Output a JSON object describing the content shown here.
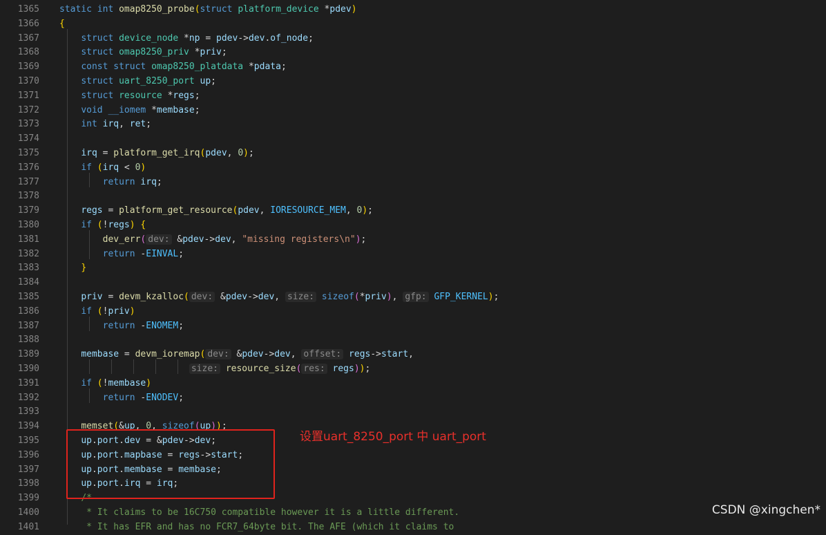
{
  "lines": [
    {
      "n": "1365",
      "t": [
        [
          "kw",
          "static "
        ],
        [
          "kw",
          "int "
        ],
        [
          "fn",
          "omap8250_probe"
        ],
        [
          "br1",
          "("
        ],
        [
          "kw",
          "struct "
        ],
        [
          "ty",
          "platform_device "
        ],
        [
          "op",
          "*"
        ],
        [
          "id",
          "pdev"
        ],
        [
          "br1",
          ")"
        ]
      ]
    },
    {
      "n": "1366",
      "t": [
        [
          "br1",
          "{"
        ]
      ]
    },
    {
      "n": "1367",
      "t": [
        [
          "op",
          "    "
        ],
        [
          "kw",
          "struct "
        ],
        [
          "ty",
          "device_node "
        ],
        [
          "op",
          "*"
        ],
        [
          "id",
          "np"
        ],
        [
          "op",
          " = "
        ],
        [
          "id",
          "pdev"
        ],
        [
          "op",
          "->"
        ],
        [
          "id",
          "dev"
        ],
        [
          "op",
          "."
        ],
        [
          "id",
          "of_node"
        ],
        [
          "op",
          ";"
        ]
      ]
    },
    {
      "n": "1368",
      "t": [
        [
          "op",
          "    "
        ],
        [
          "kw",
          "struct "
        ],
        [
          "ty",
          "omap8250_priv "
        ],
        [
          "op",
          "*"
        ],
        [
          "id",
          "priv"
        ],
        [
          "op",
          ";"
        ]
      ]
    },
    {
      "n": "1369",
      "t": [
        [
          "op",
          "    "
        ],
        [
          "kw",
          "const "
        ],
        [
          "kw",
          "struct "
        ],
        [
          "ty",
          "omap8250_platdata "
        ],
        [
          "op",
          "*"
        ],
        [
          "id",
          "pdata"
        ],
        [
          "op",
          ";"
        ]
      ]
    },
    {
      "n": "1370",
      "t": [
        [
          "op",
          "    "
        ],
        [
          "kw",
          "struct "
        ],
        [
          "ty",
          "uart_8250_port "
        ],
        [
          "id",
          "up"
        ],
        [
          "op",
          ";"
        ]
      ]
    },
    {
      "n": "1371",
      "t": [
        [
          "op",
          "    "
        ],
        [
          "kw",
          "struct "
        ],
        [
          "ty",
          "resource "
        ],
        [
          "op",
          "*"
        ],
        [
          "id",
          "regs"
        ],
        [
          "op",
          ";"
        ]
      ]
    },
    {
      "n": "1372",
      "t": [
        [
          "op",
          "    "
        ],
        [
          "kw",
          "void "
        ],
        [
          "kw",
          "__iomem "
        ],
        [
          "op",
          "*"
        ],
        [
          "id",
          "membase"
        ],
        [
          "op",
          ";"
        ]
      ]
    },
    {
      "n": "1373",
      "t": [
        [
          "op",
          "    "
        ],
        [
          "kw",
          "int "
        ],
        [
          "id",
          "irq"
        ],
        [
          "op",
          ", "
        ],
        [
          "id",
          "ret"
        ],
        [
          "op",
          ";"
        ]
      ]
    },
    {
      "n": "1374",
      "t": []
    },
    {
      "n": "1375",
      "t": [
        [
          "op",
          "    "
        ],
        [
          "id",
          "irq"
        ],
        [
          "op",
          " = "
        ],
        [
          "fn",
          "platform_get_irq"
        ],
        [
          "br1",
          "("
        ],
        [
          "id",
          "pdev"
        ],
        [
          "op",
          ", "
        ],
        [
          "num",
          "0"
        ],
        [
          "br1",
          ")"
        ],
        [
          "op",
          ";"
        ]
      ]
    },
    {
      "n": "1376",
      "t": [
        [
          "op",
          "    "
        ],
        [
          "kw",
          "if "
        ],
        [
          "br1",
          "("
        ],
        [
          "id",
          "irq"
        ],
        [
          "op",
          " < "
        ],
        [
          "num",
          "0"
        ],
        [
          "br1",
          ")"
        ]
      ]
    },
    {
      "n": "1377",
      "t": [
        [
          "op",
          "        "
        ],
        [
          "kw",
          "return "
        ],
        [
          "id",
          "irq"
        ],
        [
          "op",
          ";"
        ]
      ]
    },
    {
      "n": "1378",
      "t": []
    },
    {
      "n": "1379",
      "t": [
        [
          "op",
          "    "
        ],
        [
          "id",
          "regs"
        ],
        [
          "op",
          " = "
        ],
        [
          "fn",
          "platform_get_resource"
        ],
        [
          "br1",
          "("
        ],
        [
          "id",
          "pdev"
        ],
        [
          "op",
          ", "
        ],
        [
          "mac",
          "IORESOURCE_MEM"
        ],
        [
          "op",
          ", "
        ],
        [
          "num",
          "0"
        ],
        [
          "br1",
          ")"
        ],
        [
          "op",
          ";"
        ]
      ]
    },
    {
      "n": "1380",
      "t": [
        [
          "op",
          "    "
        ],
        [
          "kw",
          "if "
        ],
        [
          "br1",
          "("
        ],
        [
          "op",
          "!"
        ],
        [
          "id",
          "regs"
        ],
        [
          "br1",
          ")"
        ],
        [
          "op",
          " "
        ],
        [
          "br1",
          "{"
        ]
      ]
    },
    {
      "n": "1381",
      "t": [
        [
          "op",
          "        "
        ],
        [
          "fn",
          "dev_err"
        ],
        [
          "br2",
          "("
        ],
        [
          "hint",
          "dev:"
        ],
        [
          "op",
          " &"
        ],
        [
          "id",
          "pdev"
        ],
        [
          "op",
          "->"
        ],
        [
          "id",
          "dev"
        ],
        [
          "op",
          ", "
        ],
        [
          "str",
          "\"missing registers\\n\""
        ],
        [
          "br2",
          ")"
        ],
        [
          "op",
          ";"
        ]
      ]
    },
    {
      "n": "1382",
      "t": [
        [
          "op",
          "        "
        ],
        [
          "kw",
          "return "
        ],
        [
          "op",
          "-"
        ],
        [
          "mac",
          "EINVAL"
        ],
        [
          "op",
          ";"
        ]
      ]
    },
    {
      "n": "1383",
      "t": [
        [
          "op",
          "    "
        ],
        [
          "br1",
          "}"
        ]
      ]
    },
    {
      "n": "1384",
      "t": []
    },
    {
      "n": "1385",
      "t": [
        [
          "op",
          "    "
        ],
        [
          "id",
          "priv"
        ],
        [
          "op",
          " = "
        ],
        [
          "fn",
          "devm_kzalloc"
        ],
        [
          "br1",
          "("
        ],
        [
          "hint",
          "dev:"
        ],
        [
          "op",
          " &"
        ],
        [
          "id",
          "pdev"
        ],
        [
          "op",
          "->"
        ],
        [
          "id",
          "dev"
        ],
        [
          "op",
          ", "
        ],
        [
          "hint",
          "size:"
        ],
        [
          "op",
          " "
        ],
        [
          "kw",
          "sizeof"
        ],
        [
          "br2",
          "("
        ],
        [
          "op",
          "*"
        ],
        [
          "id",
          "priv"
        ],
        [
          "br2",
          ")"
        ],
        [
          "op",
          ", "
        ],
        [
          "hint",
          "gfp:"
        ],
        [
          "op",
          " "
        ],
        [
          "mac",
          "GFP_KERNEL"
        ],
        [
          "br1",
          ")"
        ],
        [
          "op",
          ";"
        ]
      ]
    },
    {
      "n": "1386",
      "t": [
        [
          "op",
          "    "
        ],
        [
          "kw",
          "if "
        ],
        [
          "br1",
          "("
        ],
        [
          "op",
          "!"
        ],
        [
          "id",
          "priv"
        ],
        [
          "br1",
          ")"
        ]
      ]
    },
    {
      "n": "1387",
      "t": [
        [
          "op",
          "        "
        ],
        [
          "kw",
          "return "
        ],
        [
          "op",
          "-"
        ],
        [
          "mac",
          "ENOMEM"
        ],
        [
          "op",
          ";"
        ]
      ]
    },
    {
      "n": "1388",
      "t": []
    },
    {
      "n": "1389",
      "t": [
        [
          "op",
          "    "
        ],
        [
          "id",
          "membase"
        ],
        [
          "op",
          " = "
        ],
        [
          "fn",
          "devm_ioremap"
        ],
        [
          "br1",
          "("
        ],
        [
          "hint",
          "dev:"
        ],
        [
          "op",
          " &"
        ],
        [
          "id",
          "pdev"
        ],
        [
          "op",
          "->"
        ],
        [
          "id",
          "dev"
        ],
        [
          "op",
          ", "
        ],
        [
          "hint",
          "offset:"
        ],
        [
          "op",
          " "
        ],
        [
          "id",
          "regs"
        ],
        [
          "op",
          "->"
        ],
        [
          "id",
          "start"
        ],
        [
          "op",
          ","
        ]
      ]
    },
    {
      "n": "1390",
      "t": [
        [
          "op",
          "                        "
        ],
        [
          "hint",
          "size:"
        ],
        [
          "op",
          " "
        ],
        [
          "fn",
          "resource_size"
        ],
        [
          "br2",
          "("
        ],
        [
          "hint",
          "res:"
        ],
        [
          "op",
          " "
        ],
        [
          "id",
          "regs"
        ],
        [
          "br2",
          ")"
        ],
        [
          "br1",
          ")"
        ],
        [
          "op",
          ";"
        ]
      ]
    },
    {
      "n": "1391",
      "t": [
        [
          "op",
          "    "
        ],
        [
          "kw",
          "if "
        ],
        [
          "br1",
          "("
        ],
        [
          "op",
          "!"
        ],
        [
          "id",
          "membase"
        ],
        [
          "br1",
          ")"
        ]
      ]
    },
    {
      "n": "1392",
      "t": [
        [
          "op",
          "        "
        ],
        [
          "kw",
          "return "
        ],
        [
          "op",
          "-"
        ],
        [
          "mac",
          "ENODEV"
        ],
        [
          "op",
          ";"
        ]
      ]
    },
    {
      "n": "1393",
      "t": []
    },
    {
      "n": "1394",
      "t": [
        [
          "op",
          "    "
        ],
        [
          "fn",
          "memset"
        ],
        [
          "br1",
          "("
        ],
        [
          "op",
          "&"
        ],
        [
          "id",
          "up"
        ],
        [
          "op",
          ", "
        ],
        [
          "num",
          "0"
        ],
        [
          "op",
          ", "
        ],
        [
          "kw",
          "sizeof"
        ],
        [
          "br2",
          "("
        ],
        [
          "id",
          "up"
        ],
        [
          "br2",
          ")"
        ],
        [
          "br1",
          ")"
        ],
        [
          "op",
          ";"
        ]
      ]
    },
    {
      "n": "1395",
      "t": [
        [
          "op",
          "    "
        ],
        [
          "id",
          "up"
        ],
        [
          "op",
          "."
        ],
        [
          "id",
          "port"
        ],
        [
          "op",
          "."
        ],
        [
          "id",
          "dev"
        ],
        [
          "op",
          " = &"
        ],
        [
          "id",
          "pdev"
        ],
        [
          "op",
          "->"
        ],
        [
          "id",
          "dev"
        ],
        [
          "op",
          ";"
        ]
      ]
    },
    {
      "n": "1396",
      "t": [
        [
          "op",
          "    "
        ],
        [
          "id",
          "up"
        ],
        [
          "op",
          "."
        ],
        [
          "id",
          "port"
        ],
        [
          "op",
          "."
        ],
        [
          "id",
          "mapbase"
        ],
        [
          "op",
          " = "
        ],
        [
          "id",
          "regs"
        ],
        [
          "op",
          "->"
        ],
        [
          "id",
          "start"
        ],
        [
          "op",
          ";"
        ]
      ]
    },
    {
      "n": "1397",
      "t": [
        [
          "op",
          "    "
        ],
        [
          "id",
          "up"
        ],
        [
          "op",
          "."
        ],
        [
          "id",
          "port"
        ],
        [
          "op",
          "."
        ],
        [
          "id",
          "membase"
        ],
        [
          "op",
          " = "
        ],
        [
          "id",
          "membase"
        ],
        [
          "op",
          ";"
        ]
      ]
    },
    {
      "n": "1398",
      "t": [
        [
          "op",
          "    "
        ],
        [
          "id",
          "up"
        ],
        [
          "op",
          "."
        ],
        [
          "id",
          "port"
        ],
        [
          "op",
          "."
        ],
        [
          "id",
          "irq"
        ],
        [
          "op",
          " = "
        ],
        [
          "id",
          "irq"
        ],
        [
          "op",
          ";"
        ]
      ]
    },
    {
      "n": "1399",
      "t": [
        [
          "op",
          "    "
        ],
        [
          "cm",
          "/*"
        ]
      ]
    },
    {
      "n": "1400",
      "t": [
        [
          "op",
          "    "
        ],
        [
          "cm",
          " * It claims to be 16C750 compatible however it is a little different."
        ]
      ]
    },
    {
      "n": "1401",
      "t": [
        [
          "op",
          "    "
        ],
        [
          "cm",
          " * It has EFR and has no FCR7_64byte bit. The AFE (which it claims to"
        ]
      ]
    }
  ],
  "annotation": "设置uart_8250_port 中 uart_port",
  "watermark": "CSDN @xingchen*",
  "colors": {
    "background": "#1e1e1e",
    "keyword": "#569cd6",
    "type": "#4ec9b0",
    "function": "#dcdcaa",
    "identifier": "#9cdcfe",
    "annotation_red": "#e0231d"
  }
}
